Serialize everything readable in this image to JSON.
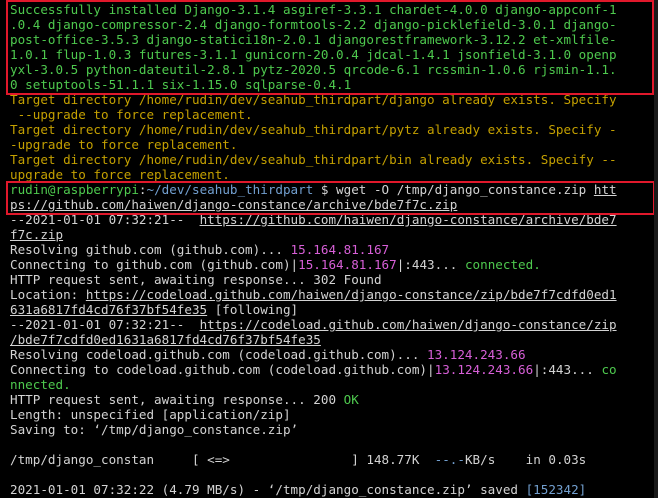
{
  "colors": {
    "background": "#000000",
    "text": "#d3d3d3",
    "success_green": "#4ec94e",
    "warning_yellow": "#c4a000",
    "ip_magenta": "#d75fd7",
    "path_blue": "#729fcf",
    "highlight_red": "#e0182b"
  },
  "lines": [
    {
      "segs": [
        {
          "t": "Successfully installed Django-3.1.4 asgiref-3.3.1 chardet-4.0.0 django-appconf-1",
          "c": "g"
        }
      ]
    },
    {
      "segs": [
        {
          "t": ".0.4 django-compressor-2.4 django-formtools-2.2 django-picklefield-3.0.1 django-",
          "c": "g"
        }
      ]
    },
    {
      "segs": [
        {
          "t": "post-office-3.5.3 django-statici18n-2.0.1 djangorestframework-3.12.2 et-xmlfile-",
          "c": "g"
        }
      ]
    },
    {
      "segs": [
        {
          "t": "1.0.1 flup-1.0.3 futures-3.1.1 gunicorn-20.0.4 jdcal-1.4.1 jsonfield-3.1.0 openp",
          "c": "g"
        }
      ]
    },
    {
      "segs": [
        {
          "t": "yxl-3.0.5 python-dateutil-2.8.1 pytz-2020.5 qrcode-6.1 rcssmin-1.0.6 rjsmin-1.1.",
          "c": "g"
        }
      ]
    },
    {
      "segs": [
        {
          "t": "0 setuptools-51.1.1 six-1.15.0 sqlparse-0.4.1",
          "c": "g"
        }
      ]
    },
    {
      "segs": [
        {
          "t": "Target directory /home/rudin/dev/seahub_thirdpart/django already exists. Specify",
          "c": "y"
        }
      ]
    },
    {
      "segs": [
        {
          "t": " --upgrade to force replacement.",
          "c": "y"
        }
      ]
    },
    {
      "segs": [
        {
          "t": "Target directory /home/rudin/dev/seahub_thirdpart/pytz already exists. Specify -",
          "c": "y"
        }
      ]
    },
    {
      "segs": [
        {
          "t": "-upgrade to force replacement.",
          "c": "y"
        }
      ]
    },
    {
      "segs": [
        {
          "t": "Target directory /home/rudin/dev/seahub_thirdpart/bin already exists. Specify --",
          "c": "y"
        }
      ]
    },
    {
      "segs": [
        {
          "t": "upgrade to force replacement.",
          "c": "y"
        }
      ]
    },
    {
      "segs": [
        {
          "t": "rudin@raspberrypi",
          "c": "g"
        },
        {
          "t": ":",
          "c": "w"
        },
        {
          "t": "~/dev/seahub_thirdpart",
          "c": "b"
        },
        {
          "t": " $ wget -O /tmp/django_constance.zip ",
          "c": "w"
        },
        {
          "t": "htt",
          "c": "w u"
        }
      ]
    },
    {
      "segs": [
        {
          "t": "ps://github.com/haiwen/django-constance/archive/bde7f7c.zip",
          "c": "w u"
        }
      ]
    },
    {
      "segs": [
        {
          "t": "--2021-01-01 07:32:21--  ",
          "c": "w"
        },
        {
          "t": "https://github.com/haiwen/django-constance/archive/bde7",
          "c": "w u"
        }
      ]
    },
    {
      "segs": [
        {
          "t": "f7c.zip",
          "c": "w u"
        }
      ]
    },
    {
      "segs": [
        {
          "t": "Resolving github.com (github.com)... ",
          "c": "w"
        },
        {
          "t": "15.164.81.167",
          "c": "m"
        }
      ]
    },
    {
      "segs": [
        {
          "t": "Connecting to github.com (github.com)|",
          "c": "w"
        },
        {
          "t": "15.164.81.167",
          "c": "m"
        },
        {
          "t": "|:443... ",
          "c": "w"
        },
        {
          "t": "connected.",
          "c": "g"
        }
      ]
    },
    {
      "segs": [
        {
          "t": "HTTP request sent, awaiting response... 302 Found",
          "c": "w"
        }
      ]
    },
    {
      "segs": [
        {
          "t": "Location: ",
          "c": "w"
        },
        {
          "t": "https://codeload.github.com/haiwen/django-constance/zip/bde7f7cdfd0ed1",
          "c": "w u"
        }
      ]
    },
    {
      "segs": [
        {
          "t": "631a6817fd4cd76f37bf54fe35",
          "c": "w u"
        },
        {
          "t": " [following]",
          "c": "w"
        }
      ]
    },
    {
      "segs": [
        {
          "t": "--2021-01-01 07:32:21--  ",
          "c": "w"
        },
        {
          "t": "https://codeload.github.com/haiwen/django-constance/zip",
          "c": "w u"
        }
      ]
    },
    {
      "segs": [
        {
          "t": "/bde7f7cdfd0ed1631a6817fd4cd76f37bf54fe35",
          "c": "w u"
        }
      ]
    },
    {
      "segs": [
        {
          "t": "Resolving codeload.github.com (codeload.github.com)... ",
          "c": "w"
        },
        {
          "t": "13.124.243.66",
          "c": "m"
        }
      ]
    },
    {
      "segs": [
        {
          "t": "Connecting to codeload.github.com (codeload.github.com)|",
          "c": "w"
        },
        {
          "t": "13.124.243.66",
          "c": "m"
        },
        {
          "t": "|:443... ",
          "c": "w"
        },
        {
          "t": "co",
          "c": "g"
        }
      ]
    },
    {
      "segs": [
        {
          "t": "nnected.",
          "c": "g"
        }
      ]
    },
    {
      "segs": [
        {
          "t": "HTTP request sent, awaiting response... 200 ",
          "c": "w"
        },
        {
          "t": "OK",
          "c": "g"
        }
      ]
    },
    {
      "segs": [
        {
          "t": "Length: unspecified [application/zip]",
          "c": "w"
        }
      ]
    },
    {
      "segs": [
        {
          "t": "Saving to: ‘/tmp/django_constance.zip’",
          "c": "w"
        }
      ]
    },
    {
      "segs": [
        {
          "t": "",
          "c": "w"
        }
      ]
    },
    {
      "segs": [
        {
          "t": "/tmp/django_constan     [ <=>                ] 148.77K  ",
          "c": "w"
        },
        {
          "t": "--.-",
          "c": "b"
        },
        {
          "t": "KB/s    in 0.03s",
          "c": "w"
        }
      ]
    },
    {
      "segs": [
        {
          "t": "",
          "c": "w"
        }
      ]
    },
    {
      "segs": [
        {
          "t": "2021-01-01 07:32:22 (4.79 MB/s) - ‘/tmp/django_constance.zip’ saved ",
          "c": "w"
        },
        {
          "t": "[152342]",
          "c": "b"
        }
      ]
    }
  ]
}
